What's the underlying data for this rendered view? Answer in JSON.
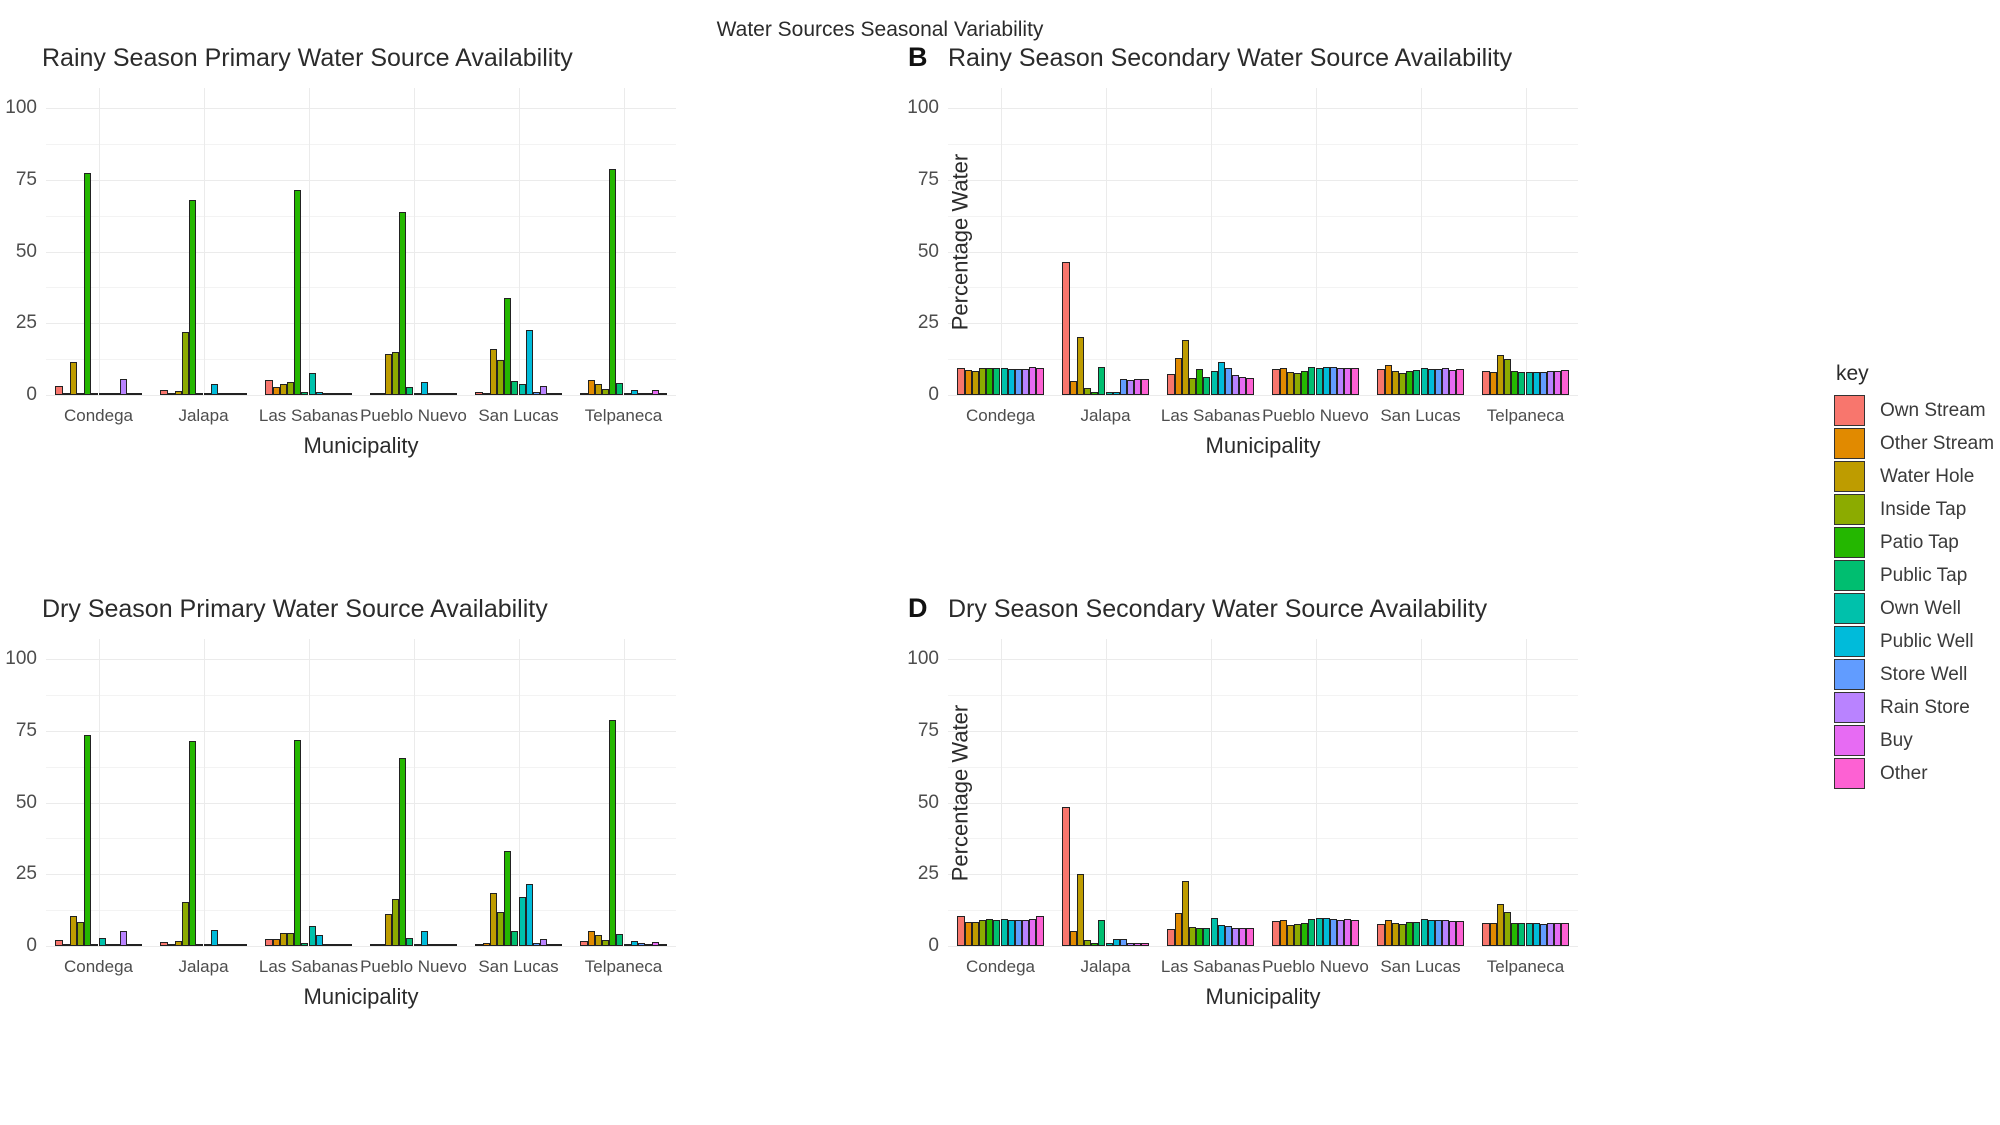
{
  "figure": {
    "suptitle": "Water Sources Seasonal Variability"
  },
  "legend": {
    "title": "key",
    "items": [
      {
        "label": "Own Stream",
        "color": "#F8766D"
      },
      {
        "label": "Other Stream",
        "color": "#E18A00"
      },
      {
        "label": "Water Hole",
        "color": "#BE9C00"
      },
      {
        "label": "Inside Tap",
        "color": "#8CAB00"
      },
      {
        "label": "Patio Tap",
        "color": "#24B700"
      },
      {
        "label": "Public Tap",
        "color": "#00BE70"
      },
      {
        "label": "Own Well",
        "color": "#00C1AB"
      },
      {
        "label": "Public Well",
        "color": "#00BBDA"
      },
      {
        "label": "Store Well",
        "color": "#619CFF"
      },
      {
        "label": "Rain Store",
        "color": "#B983FF"
      },
      {
        "label": "Buy",
        "color": "#E76BF3"
      },
      {
        "label": "Other",
        "color": "#FD61D3"
      }
    ]
  },
  "chart_data": [
    {
      "id": "A",
      "type": "bar",
      "letter": "",
      "title": "Rainy Season Primary Water Source Availability",
      "xlabel": "Municipality",
      "ylabel": "",
      "ylim": [
        0,
        107
      ],
      "yticks": [
        0,
        25,
        50,
        75,
        100
      ],
      "ytick_labels": [
        "0",
        "25",
        "50",
        "75",
        "100"
      ],
      "grid": true,
      "legend_position": "right-outside",
      "categories": [
        "Condega",
        "Jalapa",
        "Las Sabanas",
        "Pueblo Nuevo",
        "San Lucas",
        "Telpaneca"
      ],
      "series": [
        {
          "name": "Own Stream",
          "values": [
            3.0,
            1.8,
            5.2,
            0.6,
            1.0,
            0.8
          ]
        },
        {
          "name": "Other Stream",
          "values": [
            0.4,
            0.5,
            2.8,
            0.3,
            0.7,
            5.4
          ]
        },
        {
          "name": "Water Hole",
          "values": [
            11.5,
            1.5,
            3.9,
            14.2,
            16.2,
            3.8
          ]
        },
        {
          "name": "Inside Tap",
          "values": [
            0.5,
            21.8,
            4.6,
            15.0,
            12.3,
            2.0
          ]
        },
        {
          "name": "Patio Tap",
          "values": [
            77.3,
            68.0,
            71.5,
            63.7,
            33.7,
            78.9
          ]
        },
        {
          "name": "Public Tap",
          "values": [
            0.3,
            0.6,
            1.0,
            2.8,
            5.0,
            4.1
          ]
        },
        {
          "name": "Own Well",
          "values": [
            0.2,
            0.5,
            7.7,
            0.4,
            3.7,
            0.6
          ]
        },
        {
          "name": "Public Well",
          "values": [
            0.3,
            3.8,
            1.1,
            4.6,
            22.5,
            1.9
          ]
        },
        {
          "name": "Store Well",
          "values": [
            0.2,
            0.3,
            0.4,
            0.3,
            1.0,
            0.5
          ]
        },
        {
          "name": "Rain Store",
          "values": [
            5.6,
            0.3,
            0.4,
            0.2,
            3.3,
            0.5
          ]
        },
        {
          "name": "Buy",
          "values": [
            0.2,
            0.2,
            0.3,
            0.2,
            0.8,
            1.6
          ]
        },
        {
          "name": "Other",
          "values": [
            0.3,
            0.3,
            0.4,
            0.2,
            0.6,
            0.5
          ]
        }
      ]
    },
    {
      "id": "B",
      "type": "bar",
      "letter": "B",
      "title": "Rainy Season Secondary Water Source Availability",
      "xlabel": "Municipality",
      "ylabel": "Percentage Water",
      "ylim": [
        0,
        107
      ],
      "yticks": [
        0,
        25,
        50,
        75,
        100
      ],
      "ytick_labels": [
        "0",
        "25",
        "50",
        "75",
        "100"
      ],
      "grid": true,
      "legend_position": "right-outside",
      "categories": [
        "Condega",
        "Jalapa",
        "Las Sabanas",
        "Pueblo Nuevo",
        "San Lucas",
        "Telpaneca"
      ],
      "series": [
        {
          "name": "Own Stream",
          "values": [
            9.3,
            46.3,
            7.2,
            8.9,
            9.0,
            8.2
          ]
        },
        {
          "name": "Other Stream",
          "values": [
            8.6,
            5.0,
            13.0,
            9.4,
            10.3,
            8.1
          ]
        },
        {
          "name": "Water Hole",
          "values": [
            8.2,
            20.1,
            19.2,
            7.9,
            8.4,
            14.0
          ]
        },
        {
          "name": "Inside Tap",
          "values": [
            9.3,
            2.3,
            5.8,
            7.7,
            7.6,
            12.4
          ]
        },
        {
          "name": "Patio Tap",
          "values": [
            9.4,
            1.0,
            9.2,
            8.3,
            8.5,
            8.3
          ]
        },
        {
          "name": "Public Tap",
          "values": [
            9.3,
            9.6,
            6.4,
            9.6,
            8.6,
            7.9
          ]
        },
        {
          "name": "Own Well",
          "values": [
            9.5,
            1.0,
            8.3,
            9.4,
            9.4,
            7.9
          ]
        },
        {
          "name": "Public Well",
          "values": [
            9.2,
            1.0,
            11.5,
            9.7,
            8.9,
            8.1
          ]
        },
        {
          "name": "Store Well",
          "values": [
            9.1,
            5.7,
            9.3,
            9.6,
            9.1,
            8.0
          ]
        },
        {
          "name": "Rain Store",
          "values": [
            9.2,
            5.4,
            7.1,
            9.3,
            9.5,
            8.3
          ]
        },
        {
          "name": "Buy",
          "values": [
            9.8,
            5.6,
            6.3,
            9.4,
            8.8,
            8.2
          ]
        },
        {
          "name": "Other",
          "values": [
            9.4,
            5.7,
            6.1,
            9.3,
            8.9,
            8.6
          ]
        }
      ]
    },
    {
      "id": "C",
      "type": "bar",
      "letter": "",
      "title": "Dry Season Primary Water Source Availability",
      "xlabel": "Municipality",
      "ylabel": "",
      "ylim": [
        0,
        107
      ],
      "yticks": [
        0,
        25,
        50,
        75,
        100
      ],
      "ytick_labels": [
        "0",
        "25",
        "50",
        "75",
        "100"
      ],
      "grid": true,
      "legend_position": "right-outside",
      "categories": [
        "Condega",
        "Jalapa",
        "Las Sabanas",
        "Pueblo Nuevo",
        "San Lucas",
        "Telpaneca"
      ],
      "series": [
        {
          "name": "Own Stream",
          "values": [
            2.0,
            1.3,
            2.6,
            0.5,
            0.8,
            1.6
          ]
        },
        {
          "name": "Other Stream",
          "values": [
            0.5,
            0.5,
            2.4,
            0.4,
            1.0,
            5.3
          ]
        },
        {
          "name": "Water Hole",
          "values": [
            10.6,
            1.9,
            4.4,
            11.3,
            18.4,
            4.0
          ]
        },
        {
          "name": "Inside Tap",
          "values": [
            8.2,
            15.3,
            4.6,
            16.3,
            12.0,
            2.2
          ]
        },
        {
          "name": "Patio Tap",
          "values": [
            73.5,
            71.6,
            71.7,
            65.7,
            33.1,
            78.9
          ]
        },
        {
          "name": "Public Tap",
          "values": [
            0.4,
            0.6,
            1.0,
            2.7,
            5.1,
            4.2
          ]
        },
        {
          "name": "Own Well",
          "values": [
            2.7,
            0.6,
            7.0,
            0.4,
            17.0,
            0.8
          ]
        },
        {
          "name": "Public Well",
          "values": [
            0.4,
            5.7,
            4.0,
            5.2,
            21.5,
            1.6
          ]
        },
        {
          "name": "Store Well",
          "values": [
            0.3,
            0.4,
            0.6,
            0.3,
            1.2,
            0.9
          ]
        },
        {
          "name": "Rain Store",
          "values": [
            5.4,
            0.4,
            0.4,
            0.3,
            2.4,
            0.6
          ]
        },
        {
          "name": "Buy",
          "values": [
            0.3,
            0.3,
            0.4,
            0.3,
            0.7,
            1.3
          ]
        },
        {
          "name": "Other",
          "values": [
            0.3,
            0.3,
            0.4,
            0.3,
            0.7,
            0.7
          ]
        }
      ]
    },
    {
      "id": "D",
      "type": "bar",
      "letter": "D",
      "title": "Dry Season Secondary Water Source Availability",
      "xlabel": "Municipality",
      "ylabel": "Percentage Water",
      "ylim": [
        0,
        107
      ],
      "yticks": [
        0,
        25,
        50,
        75,
        100
      ],
      "ytick_labels": [
        "0",
        "25",
        "50",
        "75",
        "100"
      ],
      "grid": true,
      "legend_position": "right-outside",
      "categories": [
        "Condega",
        "Jalapa",
        "Las Sabanas",
        "Pueblo Nuevo",
        "San Lucas",
        "Telpaneca"
      ],
      "series": [
        {
          "name": "Own Stream",
          "values": [
            10.3,
            48.3,
            6.1,
            8.6,
            7.7,
            8.0
          ]
        },
        {
          "name": "Other Stream",
          "values": [
            8.4,
            5.2,
            11.5,
            9.2,
            9.1,
            7.9
          ]
        },
        {
          "name": "Water Hole",
          "values": [
            8.5,
            25.1,
            22.7,
            7.4,
            8.1,
            14.5
          ]
        },
        {
          "name": "Inside Tap",
          "values": [
            9.1,
            2.1,
            6.6,
            7.7,
            7.6,
            11.7
          ]
        },
        {
          "name": "Patio Tap",
          "values": [
            9.3,
            1.0,
            6.3,
            8.0,
            8.2,
            8.1
          ]
        },
        {
          "name": "Public Tap",
          "values": [
            9.2,
            9.2,
            6.4,
            9.4,
            8.2,
            7.9
          ]
        },
        {
          "name": "Own Well",
          "values": [
            9.3,
            1.0,
            9.8,
            9.6,
            9.3,
            7.9
          ]
        },
        {
          "name": "Public Well",
          "values": [
            9.1,
            2.3,
            7.4,
            9.8,
            9.0,
            8.0
          ]
        },
        {
          "name": "Store Well",
          "values": [
            9.0,
            2.5,
            6.9,
            9.4,
            9.0,
            7.8
          ]
        },
        {
          "name": "Rain Store",
          "values": [
            9.2,
            1.2,
            6.3,
            9.1,
            9.0,
            7.9
          ]
        },
        {
          "name": "Buy",
          "values": [
            9.4,
            1.1,
            6.2,
            9.3,
            8.6,
            8.0
          ]
        },
        {
          "name": "Other",
          "values": [
            10.3,
            1.1,
            6.3,
            9.1,
            8.8,
            8.1
          ]
        }
      ]
    }
  ]
}
